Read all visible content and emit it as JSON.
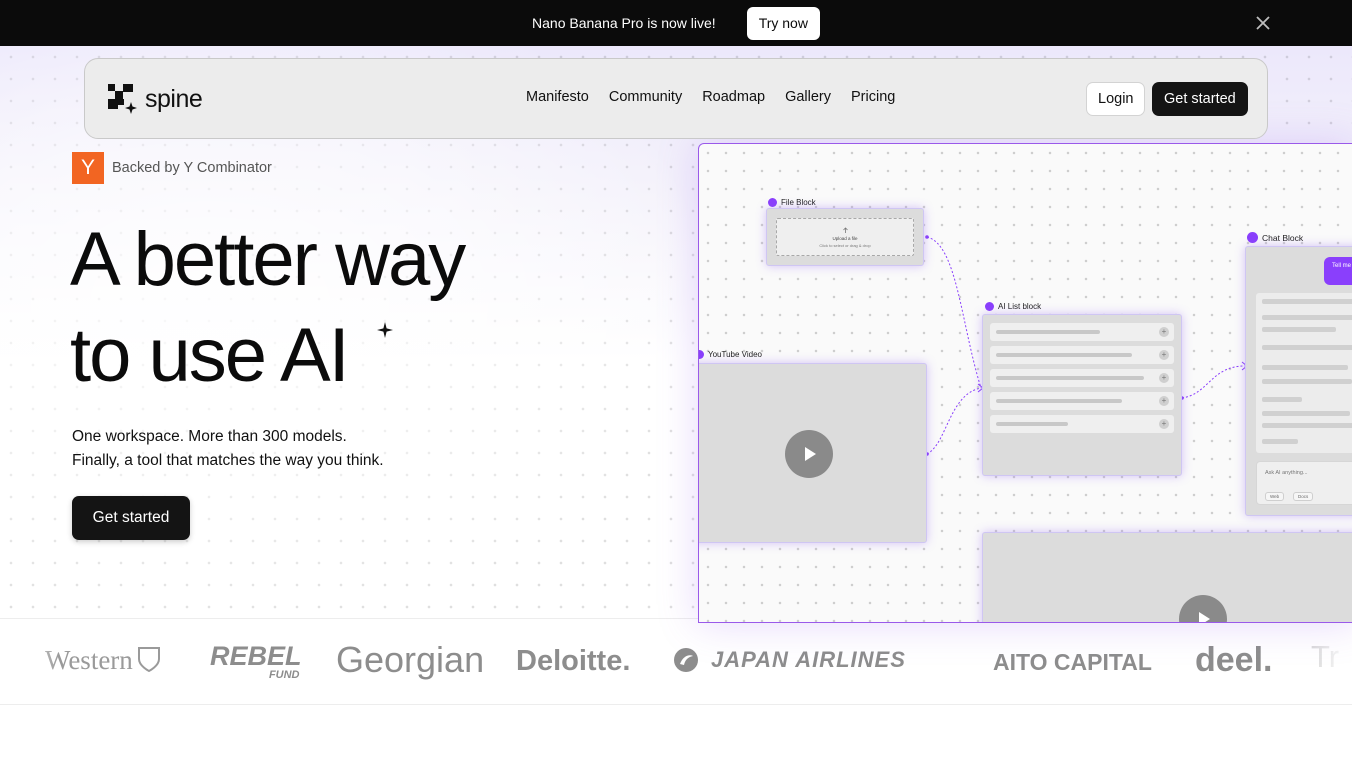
{
  "announcement": {
    "text": "Nano Banana Pro is now live!",
    "cta": "Try now"
  },
  "nav": {
    "brand": "spine",
    "links": [
      "Manifesto",
      "Community",
      "Roadmap",
      "Gallery",
      "Pricing"
    ],
    "login": "Login",
    "get_started": "Get started"
  },
  "hero": {
    "badge_letter": "Y",
    "badge_text": "Backed by Y Combinator",
    "headline_line1": "A better way",
    "headline_line2": "to use AI",
    "sub_line1": "One workspace. More than 300 models.",
    "sub_line2": "Finally, a tool that matches the way you think.",
    "cta": "Get started"
  },
  "canvas": {
    "file_block": {
      "label": "File Block",
      "upload_title": "Upload a file",
      "upload_hint": "Click to select or drag & drop"
    },
    "youtube_block": {
      "label": "YouTube Video"
    },
    "ai_list_block": {
      "label": "AI List block"
    },
    "chat_block": {
      "label": "Chat Block",
      "bubble": "Tell me conditi",
      "placeholder": "Ask AI anything...",
      "chip_web": "Web",
      "chip_docs": "Docs"
    }
  },
  "logos": [
    "Western",
    "REBEL",
    "FUND",
    "Georgian",
    "Deloitte.",
    "JAPAN AIRLINES",
    "AITO CAPITAL",
    "deel.",
    "Tr"
  ],
  "colors": {
    "accent": "#8a3ffc",
    "dark": "#141414",
    "yc_orange": "#f26522"
  }
}
